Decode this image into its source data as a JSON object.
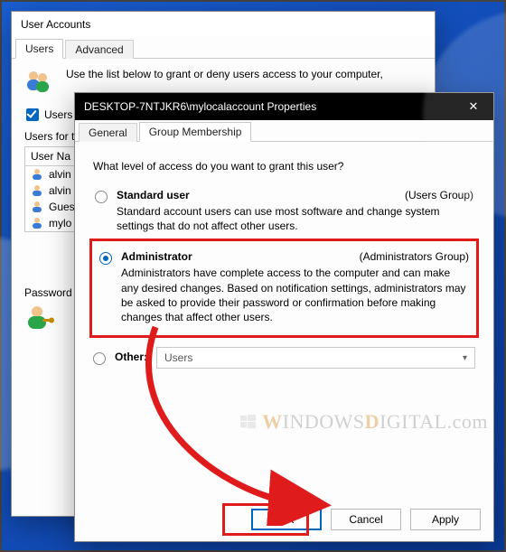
{
  "parent": {
    "title": "User Accounts",
    "tabs": {
      "users": "Users",
      "advanced": "Advanced"
    },
    "intro": "Use the list below to grant or deny users access to your computer,",
    "check_label": "Users m",
    "list_label": "Users for t",
    "col_user": "User Na",
    "rows": [
      "alvin",
      "alvin",
      "Gues",
      "mylo"
    ],
    "pw_label": "Password"
  },
  "child": {
    "title": "DESKTOP-7NTJKR6\\mylocalaccount Properties",
    "tabs": {
      "general": "General",
      "group": "Group Membership"
    },
    "prompt": "What level of access do you want to grant this user?",
    "options": {
      "standard": {
        "name": "Standard user",
        "group": "(Users Group)",
        "desc": "Standard account users can use most software and change system settings that do not affect other users."
      },
      "admin": {
        "name": "Administrator",
        "group": "(Administrators Group)",
        "desc": "Administrators have complete access to the computer and can make any desired changes. Based on notification settings, administrators may be asked to provide their password or confirmation before making changes that affect other users."
      },
      "other": {
        "name": "Other:",
        "combo_value": "Users"
      }
    },
    "buttons": {
      "ok": "OK",
      "cancel": "Cancel",
      "apply": "Apply"
    }
  },
  "watermark": {
    "a": "W",
    "b": "INDOWS",
    "c": "D",
    "d": "IGITAL",
    "e": ".com"
  }
}
